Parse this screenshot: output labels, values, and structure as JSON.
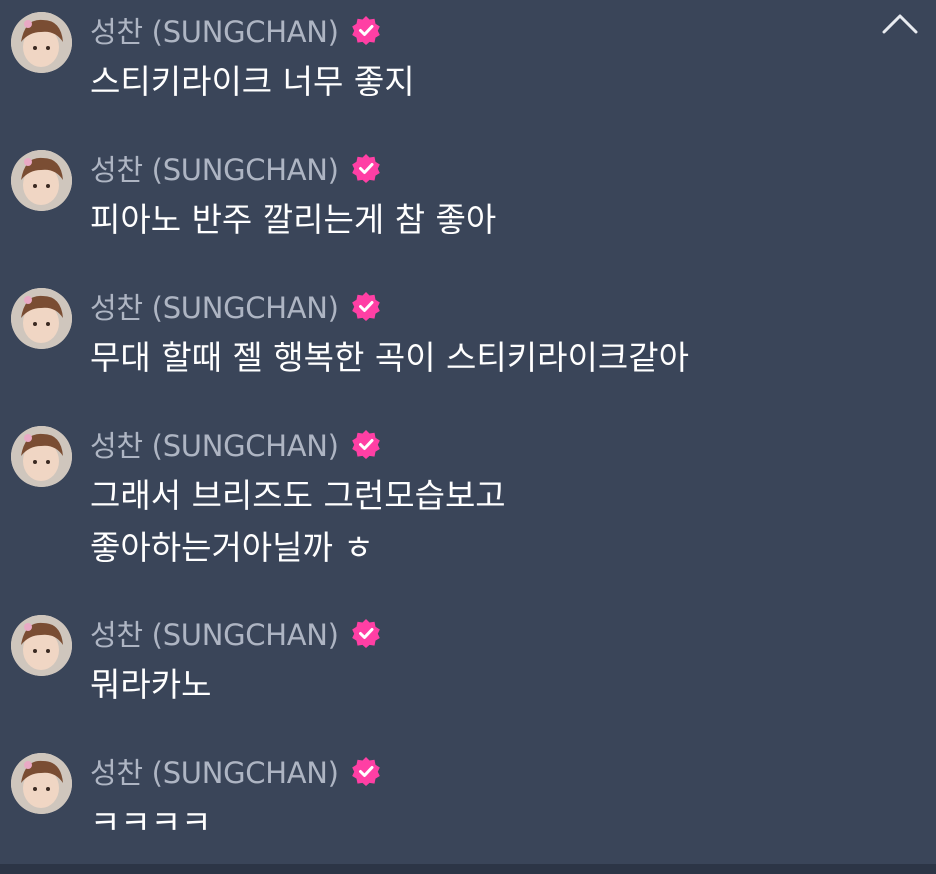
{
  "sender": {
    "name": "성찬 (SUNGCHAN)",
    "verified_icon": "verified-badge-icon",
    "avatar_icon": "avatar-photo"
  },
  "colors": {
    "background": "#3a4559",
    "sender_name": "#aeb5c3",
    "message_text": "#ffffff",
    "verified_badge": "#ff3fa4"
  },
  "controls": {
    "collapse_icon": "chevron-up-icon"
  },
  "messages": [
    {
      "sender": "성찬 (SUNGCHAN)",
      "text": "스티키라이크 너무 좋지"
    },
    {
      "sender": "성찬 (SUNGCHAN)",
      "text": "피아노 반주 깔리는게 참 좋아"
    },
    {
      "sender": "성찬 (SUNGCHAN)",
      "text": "무대 할때 젤 행복한 곡이 스티키라이크같아"
    },
    {
      "sender": "성찬 (SUNGCHAN)",
      "text": "그래서 브리즈도 그런모습보고\n좋아하는거아닐까 ㅎ"
    },
    {
      "sender": "성찬 (SUNGCHAN)",
      "text": "뭐라카노"
    },
    {
      "sender": "성찬 (SUNGCHAN)",
      "text": "ㅋㅋㅋㅋ"
    }
  ]
}
